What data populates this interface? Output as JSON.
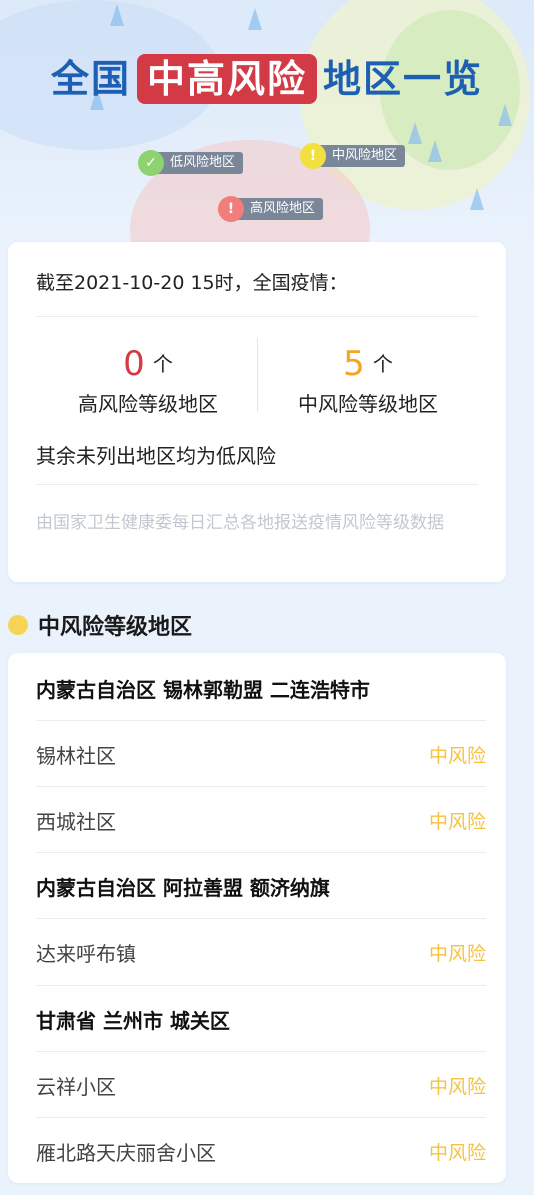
{
  "header": {
    "title_prefix": "全国",
    "title_highlight": "中高风险",
    "title_suffix": "地区一览",
    "legend": {
      "low": {
        "label": "低风险地区",
        "color": "#8dd36f"
      },
      "medium": {
        "label": "中风险地区",
        "color": "#f3df3f"
      },
      "high": {
        "label": "高风险地区",
        "color": "#f27d7a"
      }
    }
  },
  "summary": {
    "as_of": "截至2021-10-20 15时，全国疫情：",
    "high_count": "0",
    "high_unit": "个",
    "high_label": "高风险等级地区",
    "medium_count": "5",
    "medium_unit": "个",
    "medium_label": "中风险等级地区",
    "low_note": "其余未列出地区均为低风险",
    "source": "由国家卫生健康委每日汇总各地报送疫情风险等级数据",
    "colors": {
      "high": "#d23b46",
      "medium": "#f2a623"
    }
  },
  "medium_section": {
    "title": "中风险等级地区",
    "groups": [
      {
        "name": "内蒙古自治区 锡林郭勒盟 二连浩特市",
        "areas": [
          {
            "name": "锡林社区",
            "level": "中风险"
          },
          {
            "name": "西城社区",
            "level": "中风险"
          }
        ]
      },
      {
        "name": "内蒙古自治区 阿拉善盟 额济纳旗",
        "areas": [
          {
            "name": "达来呼布镇",
            "level": "中风险"
          }
        ]
      },
      {
        "name": "甘肃省 兰州市 城关区",
        "areas": [
          {
            "name": "云祥小区",
            "level": "中风险"
          },
          {
            "name": "雁北路天庆丽舍小区",
            "level": "中风险"
          }
        ]
      }
    ]
  }
}
